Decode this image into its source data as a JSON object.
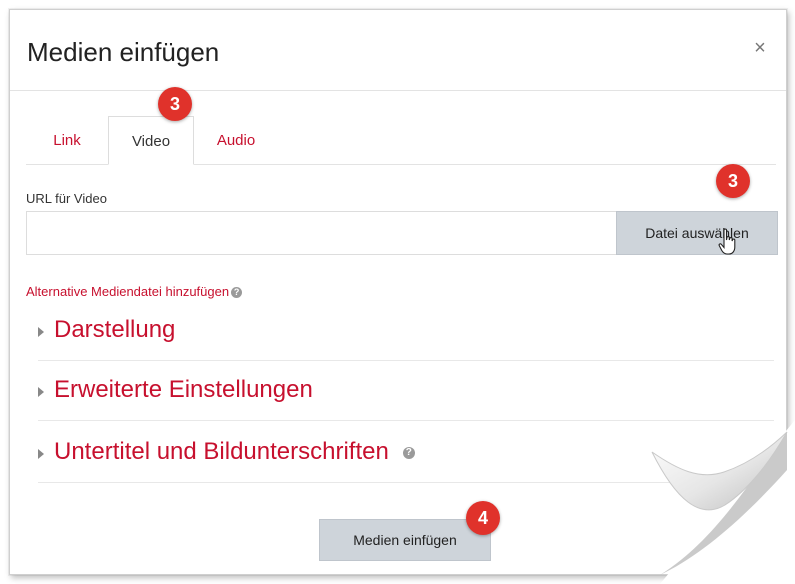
{
  "dialog": {
    "title": "Medien einfügen",
    "close_label": "×"
  },
  "tabs": [
    {
      "label": "Link",
      "active": false
    },
    {
      "label": "Video",
      "active": true
    },
    {
      "label": "Audio",
      "active": false
    }
  ],
  "badges": {
    "tab_step": "3",
    "file_step": "3",
    "submit_step": "4"
  },
  "video": {
    "url_label": "URL für Video",
    "url_value": "",
    "file_button_label": "Datei auswählen"
  },
  "alternative_link": "Alternative Mediendatei hinzufügen",
  "sections": [
    {
      "label": "Darstellung",
      "help": false
    },
    {
      "label": "Erweiterte Einstellungen",
      "help": false
    },
    {
      "label": "Untertitel und Bildunterschriften",
      "help": true
    }
  ],
  "footer": {
    "submit_label": "Medien einfügen"
  },
  "colors": {
    "accent": "#c7102e",
    "badge": "#e0322b",
    "button": "#ced4da"
  },
  "icons": {
    "close": "close-icon",
    "help": "help-icon",
    "caret": "caret-right-icon",
    "cursor": "hand-pointer-icon"
  }
}
